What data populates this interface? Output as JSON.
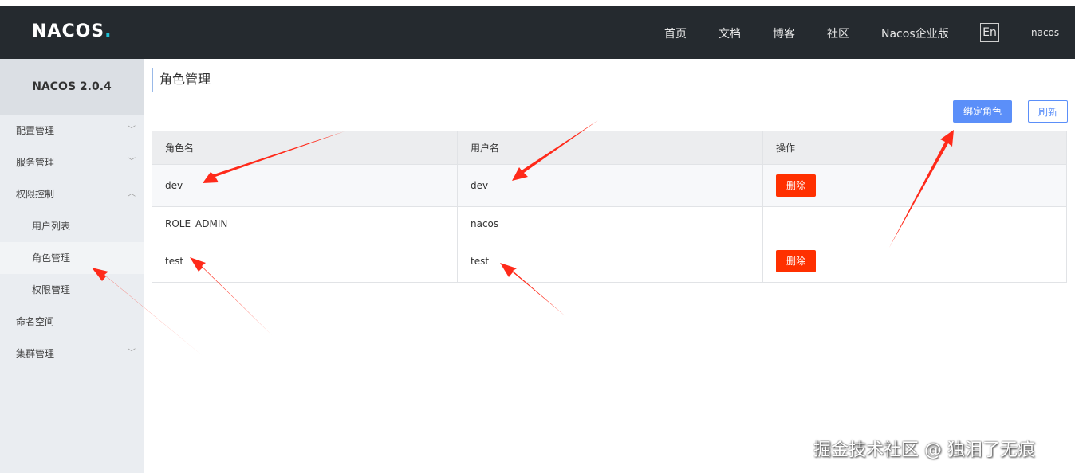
{
  "brand": {
    "name": "NACOS",
    "dot": "."
  },
  "nav": {
    "home": "首页",
    "docs": "文档",
    "blog": "博客",
    "community": "社区",
    "enterprise": "Nacos企业版",
    "lang": "En",
    "user": "nacos"
  },
  "sidebar": {
    "version": "NACOS 2.0.4",
    "items": [
      {
        "label": "配置管理"
      },
      {
        "label": "服务管理"
      },
      {
        "label": "权限控制"
      },
      {
        "label": "用户列表"
      },
      {
        "label": "角色管理"
      },
      {
        "label": "权限管理"
      },
      {
        "label": "命名空间"
      },
      {
        "label": "集群管理"
      }
    ]
  },
  "page": {
    "title": "角色管理",
    "bind_role_button": "绑定角色",
    "refresh_button": "刷新"
  },
  "table": {
    "columns": [
      "角色名",
      "用户名",
      "操作"
    ],
    "rows": [
      {
        "role": "dev",
        "user": "dev",
        "action": "删除"
      },
      {
        "role": "ROLE_ADMIN",
        "user": "nacos",
        "action": ""
      },
      {
        "role": "test",
        "user": "test",
        "action": "删除"
      }
    ]
  },
  "watermark": "掘金技术社区 @ 独泪了无痕",
  "colors": {
    "accent": "#5b8ff9",
    "danger": "#ff3000",
    "annotation": "#ff2a1a"
  }
}
